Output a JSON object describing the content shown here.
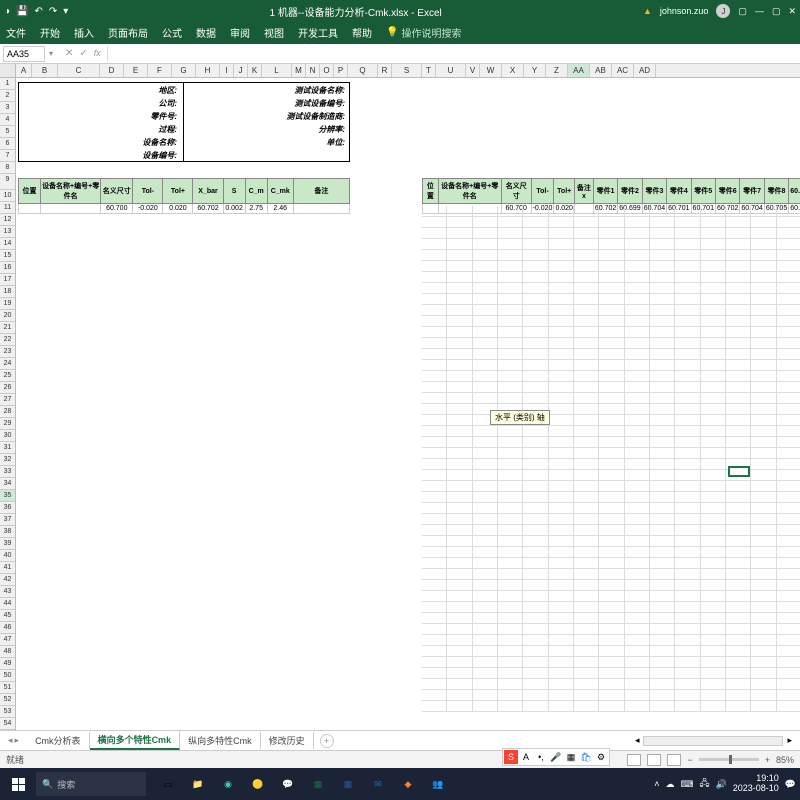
{
  "titlebar": {
    "title": "1 机器--设备能力分析-Cmk.xlsx - Excel",
    "user": "johnson.zuo"
  },
  "ribbon": {
    "file": "文件",
    "home": "开始",
    "insert": "插入",
    "layout": "页面布局",
    "formula": "公式",
    "data": "数据",
    "review": "审阅",
    "view": "视图",
    "dev": "开发工具",
    "help": "帮助",
    "tell": "操作说明搜索"
  },
  "namebox": {
    "value": "AA35"
  },
  "cols": [
    "A",
    "B",
    "C",
    "D",
    "E",
    "F",
    "G",
    "H",
    "I",
    "J",
    "K",
    "L",
    "M",
    "N",
    "O",
    "P",
    "Q",
    "R",
    "S",
    "T",
    "U",
    "V",
    "W",
    "X",
    "Y",
    "Z",
    "AA",
    "AB",
    "AC",
    "AD"
  ],
  "form": {
    "l1": "地区:",
    "l2": "公司:",
    "l3": "零件号:",
    "l4": "过程:",
    "l5": "设备名称:",
    "l6": "设备编号:",
    "r1": "测试设备名称:",
    "r2": "测试设备编号:",
    "r3": "测试设备制造商:",
    "r4": "分辨率:",
    "r5": "单位:"
  },
  "t1": {
    "h": [
      "位置",
      "设备名称+编号+零件名",
      "名义尺寸",
      "Tol-",
      "Tol+",
      "X_bar",
      "S",
      "C_m",
      "C_mk",
      "备注"
    ],
    "r": [
      "",
      "",
      "60.700",
      "-0.020",
      "0.020",
      "60.702",
      "0.002",
      "2.75",
      "2.46",
      ""
    ]
  },
  "t2": {
    "h": [
      "位置",
      "设备名称+编号+零件名",
      "名义尺寸",
      "Tol-",
      "Tol+",
      "备注x",
      "零件1",
      "零件2",
      "零件3",
      "零件4",
      "零件5",
      "零件6",
      "零件7",
      "零件8",
      "60."
    ],
    "r": [
      "",
      "",
      "60.700",
      "-0.020",
      "0.020",
      "",
      "60.702",
      "60.699",
      "60.704",
      "60.701",
      "60.701",
      "60.702",
      "60.704",
      "60.705",
      "60."
    ]
  },
  "tooltip": "水平 (类别) 轴",
  "tabs": {
    "t1": "Cmk分析表",
    "t2": "横向多个特性Cmk",
    "t3": "纵向多特性Cmk",
    "t4": "修改历史"
  },
  "status": {
    "ready": "就绪",
    "zoom": "85%"
  },
  "taskbar": {
    "search": "搜索",
    "time": "19:10",
    "date": "2023-08-10"
  },
  "chart_data": {
    "type": "table",
    "title": "设备能力分析 Cmk",
    "series": [
      {
        "name": "横向多个特性Cmk",
        "nominal": 60.7,
        "tol_minus": -0.02,
        "tol_plus": 0.02,
        "x_bar": 60.702,
        "s": 0.002,
        "cm": 2.75,
        "cmk": 2.46,
        "parts": [
          60.702,
          60.699,
          60.704,
          60.701,
          60.701,
          60.702,
          60.704,
          60.705
        ]
      }
    ]
  }
}
